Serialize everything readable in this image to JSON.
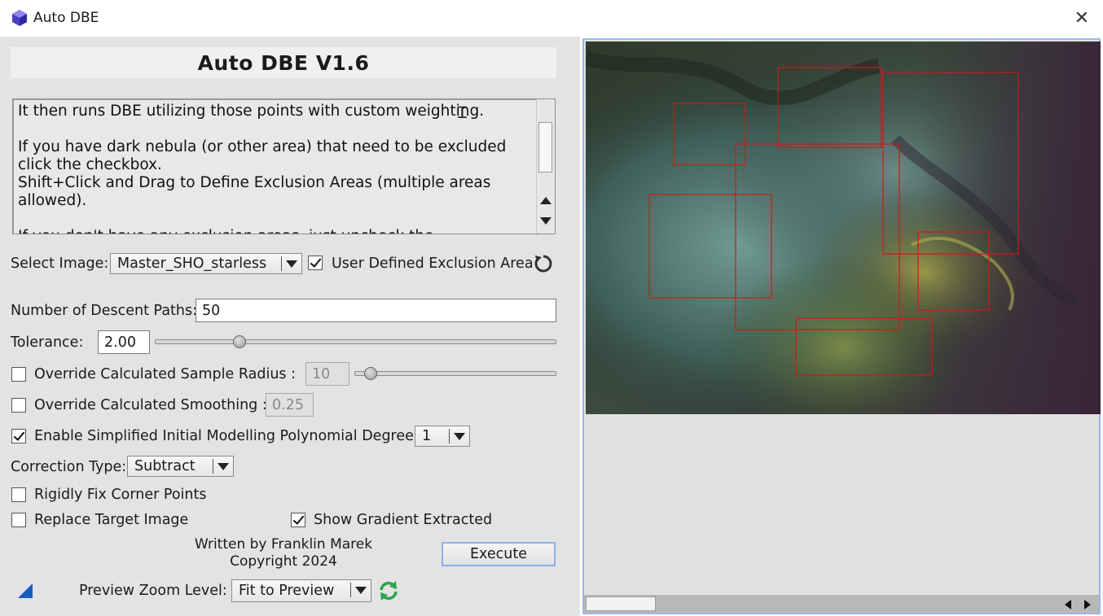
{
  "window": {
    "title": "Auto DBE",
    "close_glyph": "✕",
    "app_icon": "purple-gem-icon"
  },
  "header": {
    "title": "Auto DBE V1.6"
  },
  "description": {
    "text": "It then runs DBE utilizing those points with custom weighting.\n\nIf you have dark nebula (or other area) that need to be excluded click the checkbox.\nShift+Click and Drag to Define Exclusion Areas (multiple areas allowed).\n\nIf you don't have any exclusion areas, just uncheck the"
  },
  "select_image": {
    "label": "Select Image:",
    "value": "Master_SHO_starless",
    "user_defined_label": "User Defined Exclusion Area",
    "user_defined_checked": true,
    "reset_icon": "reset-icon"
  },
  "descent_paths": {
    "label": "Number of Descent Paths:",
    "value": "50"
  },
  "tolerance": {
    "label": "Tolerance:",
    "value": "2.00",
    "slider_fraction": 0.21
  },
  "sample_radius": {
    "label": "Override Calculated Sample Radius :",
    "value": "10",
    "checked": false,
    "slider_fraction": 0.08
  },
  "smoothing": {
    "label": "Override Calculated Smoothing :",
    "value": "0.25",
    "checked": false
  },
  "polynomial": {
    "label": "Enable Simplified Initial Modelling Polynomial Degree:",
    "checked": true,
    "value": "1"
  },
  "correction": {
    "label": "Correction Type:",
    "value": "Subtract"
  },
  "corner_points": {
    "label": "Rigidly Fix Corner Points",
    "checked": false
  },
  "replace_target": {
    "label": "Replace Target Image",
    "checked": false
  },
  "show_gradient": {
    "label": "Show Gradient Extracted",
    "checked": true
  },
  "credits": {
    "line1": "Written by Franklin Marek",
    "line2": "Copyright 2024"
  },
  "footer": {
    "zoom_label": "Preview Zoom Level:",
    "zoom_value": "Fit to Preview",
    "execute_label": "Execute",
    "refresh_icon": "refresh-icon",
    "corner_icon": "resize-corner-icon"
  },
  "colors": {
    "panel_bg": "#e3e3e3",
    "exclusion_box": "#d01818",
    "focus_border": "#99b6e8",
    "refresh_green": "#2aa64a"
  }
}
